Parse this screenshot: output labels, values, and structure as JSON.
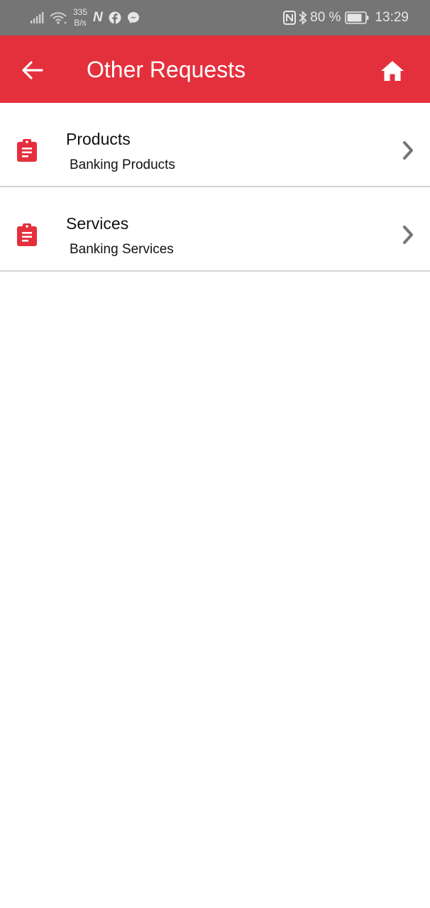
{
  "status_bar": {
    "network_speed_value": "335",
    "network_speed_unit": "B/s",
    "nfc_letter": "N",
    "battery_text": "80 %",
    "time": "13:29",
    "icons": [
      "signal-icon",
      "wifi-icon",
      "nfc-n-icon",
      "facebook-icon",
      "messenger-icon",
      "nfc-icon",
      "bluetooth-icon",
      "battery-icon"
    ]
  },
  "app_bar": {
    "title": "Other Requests",
    "back_icon": "arrow-left-icon",
    "home_icon": "home-icon",
    "color": "#e4303c"
  },
  "list": {
    "items": [
      {
        "title": "Products",
        "subtitle": "Banking Products",
        "icon": "clipboard-icon"
      },
      {
        "title": "Services",
        "subtitle": "Banking Services",
        "icon": "clipboard-icon"
      }
    ]
  },
  "colors": {
    "accent": "#e4303c",
    "status_bar": "#757575",
    "chevron": "#757575",
    "divider": "#d4d4d4"
  }
}
